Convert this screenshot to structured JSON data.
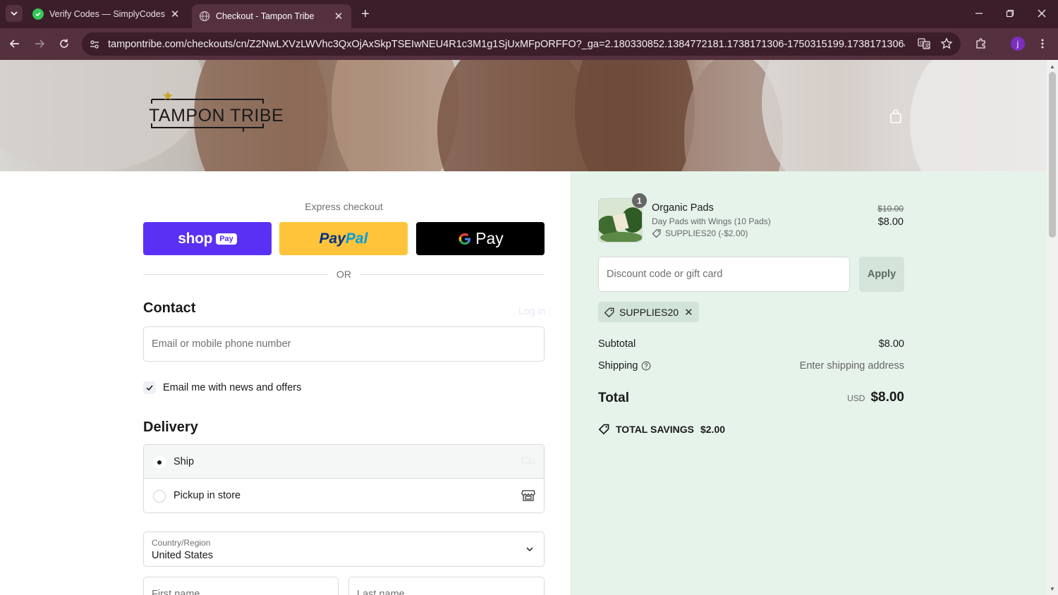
{
  "browser": {
    "tabs": [
      {
        "title": "Verify Codes — SimplyCodes",
        "active": false
      },
      {
        "title": "Checkout - Tampon Tribe",
        "active": true
      }
    ],
    "url": "tampontribe.com/checkouts/cn/Z2NwLXVzLWVhc3QxOjAxSkpTSEIwNEU4R1c3M1g1SjUxMFpORFFO?_ga=2.180330852.1384772181.1738171306-1750315199.1738171306&auto_redirect=...",
    "profile_initial": "j"
  },
  "header": {
    "logo_text": "TAMPON TRIBE"
  },
  "checkout": {
    "express_label": "Express checkout",
    "shop_pay": {
      "word": "shop",
      "badge": "Pay"
    },
    "paypal": {
      "part1": "Pay",
      "part2": "Pal"
    },
    "gpay": {
      "word": "Pay"
    },
    "or_text": "OR",
    "contact": {
      "title": "Contact",
      "login_link": "Log in",
      "email_placeholder": "Email or mobile phone number",
      "newsletter_label": "Email me with news and offers",
      "newsletter_checked": true
    },
    "delivery": {
      "title": "Delivery",
      "options": [
        {
          "label": "Ship",
          "selected": true
        },
        {
          "label": "Pickup in store",
          "selected": false
        }
      ],
      "country_label": "Country/Region",
      "country_value": "United States",
      "first_name_placeholder": "First name",
      "last_name_placeholder": "Last name"
    }
  },
  "summary": {
    "item": {
      "quantity": "1",
      "name": "Organic Pads",
      "variant": "Day Pads with Wings (10 Pads)",
      "discount": "SUPPLIES20 (-$2.00)",
      "original_price": "$10.00",
      "price": "$8.00"
    },
    "discount_placeholder": "Discount code or gift card",
    "apply_label": "Apply",
    "applied_code": "SUPPLIES20",
    "subtotal_label": "Subtotal",
    "subtotal_value": "$8.00",
    "shipping_label": "Shipping",
    "shipping_value": "Enter shipping address",
    "total_label": "Total",
    "total_currency": "USD",
    "total_value": "$8.00",
    "savings_label": "TOTAL SAVINGS",
    "savings_value": "$2.00"
  },
  "colors": {
    "shop_pay": "#5a31f4",
    "paypal": "#ffc439",
    "gpay": "#000000",
    "summary_bg": "#e6f3ea",
    "chrome": "#55303f"
  }
}
